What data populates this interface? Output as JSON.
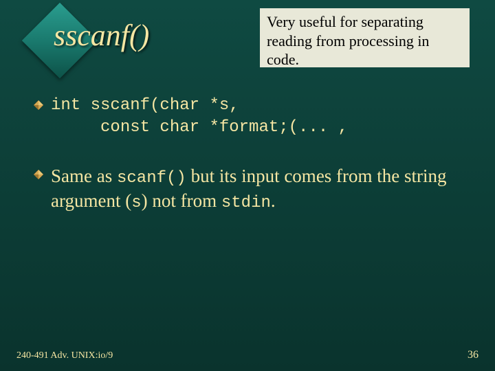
{
  "title": "sscanf()",
  "callout": "Very useful for separating reading from processing in code.",
  "code": {
    "line1": "int sscanf(char *s,",
    "line2": "     const char *format;(... ,"
  },
  "prose": {
    "pre1": "Same as ",
    "mono1": "scanf()",
    "mid1": " but its input comes from the string argument (",
    "mono2": "s",
    "mid2": ") not from ",
    "mono3": "stdin",
    "end": "."
  },
  "footer": {
    "left": "240-491 Adv. UNIX:io/9",
    "right": "36"
  }
}
